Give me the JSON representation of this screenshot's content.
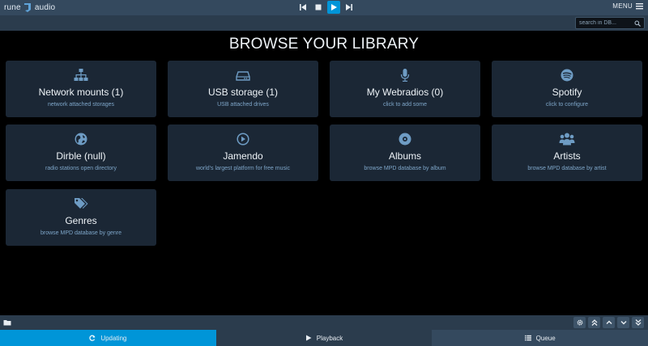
{
  "header": {
    "logo_left": "rune",
    "logo_right": "audio",
    "menu_label": "MENU"
  },
  "search": {
    "placeholder": "search in DB..."
  },
  "page": {
    "title": "BROWSE YOUR LIBRARY"
  },
  "tiles": [
    {
      "icon": "network-icon",
      "title": "Network mounts (1)",
      "subtitle": "network attached storages"
    },
    {
      "icon": "hard-drive-icon",
      "title": "USB storage (1)",
      "subtitle": "USB attached drives"
    },
    {
      "icon": "microphone-icon",
      "title": "My Webradios (0)",
      "subtitle": "click to add some"
    },
    {
      "icon": "spotify-icon",
      "title": "Spotify",
      "subtitle": "click to configure"
    },
    {
      "icon": "globe-icon",
      "title": "Dirble (null)",
      "subtitle": "radio stations open directory"
    },
    {
      "icon": "play-circle-icon",
      "title": "Jamendo",
      "subtitle": "world's largest platform for free music"
    },
    {
      "icon": "disc-icon",
      "title": "Albums",
      "subtitle": "browse MPD database by album"
    },
    {
      "icon": "users-icon",
      "title": "Artists",
      "subtitle": "browse MPD database by artist"
    },
    {
      "icon": "tags-icon",
      "title": "Genres",
      "subtitle": "browse MPD database by genre"
    }
  ],
  "tabs": [
    {
      "label": "Updating",
      "icon": "refresh-icon"
    },
    {
      "label": "Playback",
      "icon": "play-icon"
    },
    {
      "label": "Queue",
      "icon": "list-icon"
    }
  ],
  "colors": {
    "accent": "#0095d8",
    "topbar": "#34495e",
    "tile_bg": "#1b2735",
    "icon": "#6e9cc4",
    "subtitle": "#7ea6c9"
  }
}
